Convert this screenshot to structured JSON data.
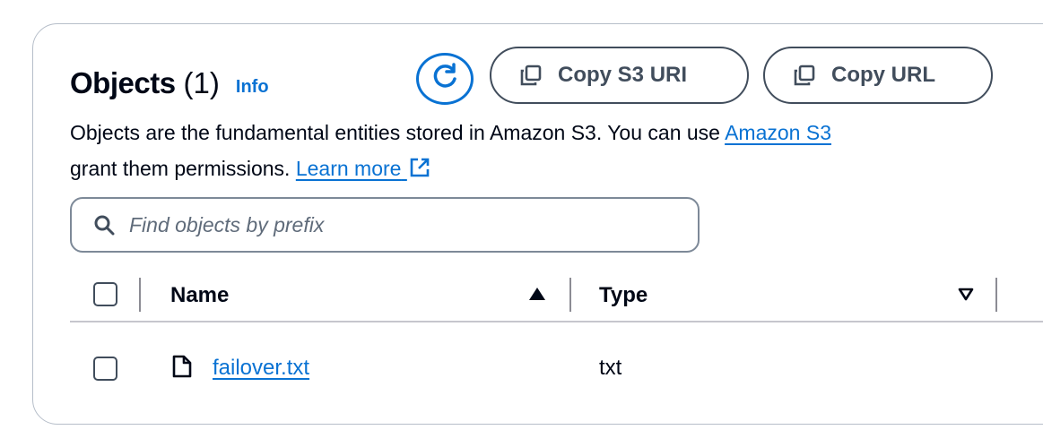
{
  "header": {
    "title": "Objects",
    "count": "(1)",
    "info_label": "Info"
  },
  "actions": {
    "copy_s3_uri": "Copy S3 URI",
    "copy_url": "Copy URL"
  },
  "description": {
    "line1_text": "Objects are the fundamental entities stored in Amazon S3. You can use ",
    "line1_link": "Amazon S3",
    "line2_text": "grant them permissions. ",
    "learn_more": "Learn more"
  },
  "search": {
    "placeholder": "Find objects by prefix"
  },
  "table": {
    "columns": [
      {
        "label": "Name",
        "sort": "ascending"
      },
      {
        "label": "Type",
        "sort": "descending"
      }
    ],
    "rows": [
      {
        "name": "failover.txt",
        "type": "txt"
      }
    ]
  },
  "colors": {
    "accent": "#0972d3",
    "text": "#000716",
    "border": "#b6bec9"
  },
  "icons": [
    "refresh-icon",
    "copy-icon",
    "external-link-icon",
    "search-icon",
    "file-icon",
    "sort-ascending-icon",
    "sort-descending-icon"
  ]
}
